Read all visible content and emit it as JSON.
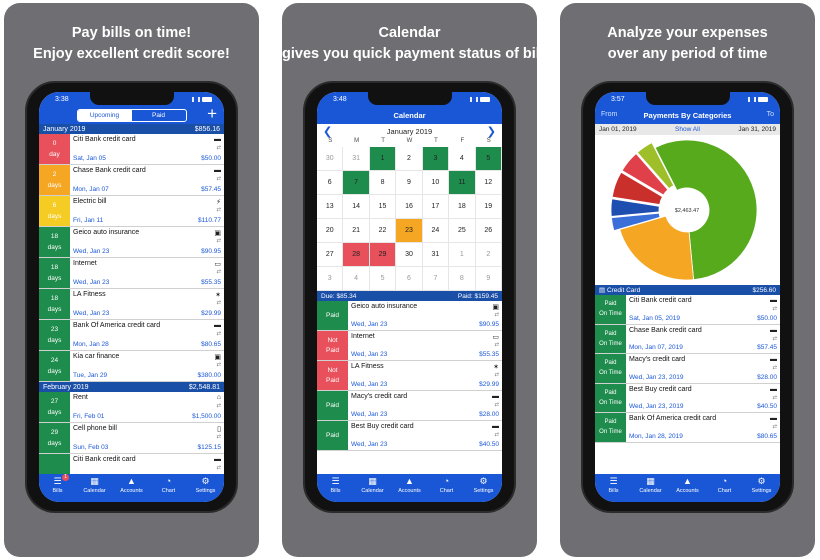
{
  "panels": [
    {
      "heading": [
        "Pay bills on time!",
        "Enjoy excellent credit score!"
      ]
    },
    {
      "heading": [
        "Calendar",
        "gives you quick payment status of bills"
      ]
    },
    {
      "heading": [
        "Analyze your expenses",
        "over any period of time"
      ]
    }
  ],
  "screen1": {
    "time": "3:38",
    "segments": [
      "Upcoming",
      "Paid"
    ],
    "add_label": "+",
    "groups": [
      {
        "month": "January 2019",
        "total": "$856.16",
        "rows": [
          {
            "count": "0",
            "unit": "day",
            "color": "#e8505b",
            "name": "Citi Bank credit card",
            "date": "Sat, Jan 05",
            "amount": "$50.00",
            "icon": "credit-card-icon"
          },
          {
            "count": "2",
            "unit": "days",
            "color": "#f5a623",
            "name": "Chase Bank credit card",
            "date": "Mon, Jan 07",
            "amount": "$57.45",
            "icon": "credit-card-icon"
          },
          {
            "count": "6",
            "unit": "days",
            "color": "#f5cc23",
            "name": "Electric bill",
            "date": "Fri, Jan 11",
            "amount": "$110.77",
            "icon": "bolt-icon"
          },
          {
            "count": "18",
            "unit": "days",
            "color": "#1e8c4c",
            "name": "Geico auto insurance",
            "date": "Wed, Jan 23",
            "amount": "$90.95",
            "icon": "car-icon"
          },
          {
            "count": "18",
            "unit": "days",
            "color": "#1e8c4c",
            "name": "Internet",
            "date": "Wed, Jan 23",
            "amount": "$55.35",
            "icon": "monitor-icon"
          },
          {
            "count": "18",
            "unit": "days",
            "color": "#1e8c4c",
            "name": "LA Fitness",
            "date": "Wed, Jan 23",
            "amount": "$29.99",
            "icon": "fitness-icon"
          },
          {
            "count": "23",
            "unit": "days",
            "color": "#1e8c4c",
            "name": "Bank Of America credit card",
            "date": "Mon, Jan 28",
            "amount": "$80.65",
            "icon": "credit-card-icon"
          },
          {
            "count": "24",
            "unit": "days",
            "color": "#1e8c4c",
            "name": "Kia car finance",
            "date": "Tue, Jan 29",
            "amount": "$380.00",
            "icon": "car-icon"
          }
        ]
      },
      {
        "month": "February 2019",
        "total": "$2,548.81",
        "rows": [
          {
            "count": "27",
            "unit": "days",
            "color": "#1e8c4c",
            "name": "Rent",
            "date": "Fri, Feb 01",
            "amount": "$1,500.00",
            "icon": "home-icon"
          },
          {
            "count": "29",
            "unit": "days",
            "color": "#1e8c4c",
            "name": "Cell phone bill",
            "date": "Sun, Feb 03",
            "amount": "$125.15",
            "icon": "phone-icon"
          },
          {
            "count": "",
            "unit": "",
            "color": "#1e8c4c",
            "name": "Citi Bank credit card",
            "date": "",
            "amount": "",
            "icon": "credit-card-icon"
          }
        ]
      }
    ]
  },
  "screen2": {
    "time": "3:48",
    "title": "Calendar",
    "month": "January 2019",
    "dow": [
      "S",
      "M",
      "T",
      "W",
      "T",
      "F",
      "S"
    ],
    "days": [
      {
        "d": "30",
        "s": "muted"
      },
      {
        "d": "31",
        "s": "muted"
      },
      {
        "d": "1",
        "s": "green"
      },
      {
        "d": "2",
        "s": ""
      },
      {
        "d": "3",
        "s": "green"
      },
      {
        "d": "4",
        "s": ""
      },
      {
        "d": "5",
        "s": "green"
      },
      {
        "d": "6",
        "s": ""
      },
      {
        "d": "7",
        "s": "green"
      },
      {
        "d": "8",
        "s": ""
      },
      {
        "d": "9",
        "s": ""
      },
      {
        "d": "10",
        "s": ""
      },
      {
        "d": "11",
        "s": "green"
      },
      {
        "d": "12",
        "s": ""
      },
      {
        "d": "13",
        "s": ""
      },
      {
        "d": "14",
        "s": ""
      },
      {
        "d": "15",
        "s": ""
      },
      {
        "d": "16",
        "s": ""
      },
      {
        "d": "17",
        "s": ""
      },
      {
        "d": "18",
        "s": ""
      },
      {
        "d": "19",
        "s": ""
      },
      {
        "d": "20",
        "s": ""
      },
      {
        "d": "21",
        "s": ""
      },
      {
        "d": "22",
        "s": ""
      },
      {
        "d": "23",
        "s": "orange"
      },
      {
        "d": "24",
        "s": ""
      },
      {
        "d": "25",
        "s": ""
      },
      {
        "d": "26",
        "s": ""
      },
      {
        "d": "27",
        "s": ""
      },
      {
        "d": "28",
        "s": "red"
      },
      {
        "d": "29",
        "s": "red"
      },
      {
        "d": "30",
        "s": ""
      },
      {
        "d": "31",
        "s": ""
      },
      {
        "d": "1",
        "s": "muted"
      },
      {
        "d": "2",
        "s": "muted"
      },
      {
        "d": "3",
        "s": "muted"
      },
      {
        "d": "4",
        "s": "muted"
      },
      {
        "d": "5",
        "s": "muted"
      },
      {
        "d": "6",
        "s": "muted"
      },
      {
        "d": "7",
        "s": "muted"
      },
      {
        "d": "8",
        "s": "muted"
      },
      {
        "d": "9",
        "s": "muted"
      }
    ],
    "due_label": "Due: $85.34",
    "paid_label": "Paid: $159.45",
    "rows": [
      {
        "status": [
          "Paid"
        ],
        "color": "#1e8c4c",
        "name": "Geico auto insurance",
        "date": "Wed, Jan 23",
        "amount": "$90.95",
        "icon": "car-icon"
      },
      {
        "status": [
          "Not",
          "Paid"
        ],
        "color": "#e8505b",
        "name": "Internet",
        "date": "Wed, Jan 23",
        "amount": "$55.35",
        "icon": "monitor-icon"
      },
      {
        "status": [
          "Not",
          "Paid"
        ],
        "color": "#e8505b",
        "name": "LA Fitness",
        "date": "Wed, Jan 23",
        "amount": "$29.99",
        "icon": "fitness-icon"
      },
      {
        "status": [
          "Paid"
        ],
        "color": "#1e8c4c",
        "name": "Macy's credit card",
        "date": "Wed, Jan 23",
        "amount": "$28.00",
        "icon": "credit-card-icon"
      },
      {
        "status": [
          "Paid"
        ],
        "color": "#1e8c4c",
        "name": "Best Buy credit card",
        "date": "Wed, Jan 23",
        "amount": "$40.50",
        "icon": "credit-card-icon"
      }
    ]
  },
  "screen3": {
    "time": "3:57",
    "title": "Payments By Categories",
    "from_label": "From",
    "to_label": "To",
    "from_date": "Jan 01, 2019",
    "show_all": "Show All",
    "to_date": "Jan 31, 2019",
    "center_total": "$2,463.47",
    "slices": [
      {
        "value": 0.56,
        "color": "#56aa1c"
      },
      {
        "value": 0.22,
        "color": "#f5a623"
      },
      {
        "value": 0.03,
        "color": "#3a6ed8"
      },
      {
        "value": 0.04,
        "color": "#1e4fb0"
      },
      {
        "value": 0.06,
        "color": "#c9302c"
      },
      {
        "value": 0.05,
        "color": "#e0404a"
      },
      {
        "value": 0.04,
        "color": "#9fbf2a"
      }
    ],
    "category_label": "Credit Card",
    "category_total": "$256.60",
    "rows": [
      {
        "status": [
          "Paid",
          "On Time"
        ],
        "name": "Citi Bank credit card",
        "date": "Sat, Jan 05, 2019",
        "amount": "$50.00"
      },
      {
        "status": [
          "Paid",
          "On Time"
        ],
        "name": "Chase Bank credit card",
        "date": "Mon, Jan 07, 2019",
        "amount": "$57.45"
      },
      {
        "status": [
          "Paid",
          "On Time"
        ],
        "name": "Macy's credit card",
        "date": "Wed, Jan 23, 2019",
        "amount": "$28.00"
      },
      {
        "status": [
          "Paid",
          "On Time"
        ],
        "name": "Best Buy credit card",
        "date": "Wed, Jan 23, 2019",
        "amount": "$40.50"
      },
      {
        "status": [
          "Paid",
          "On Time"
        ],
        "name": "Bank Of America credit card",
        "date": "Mon, Jan 28, 2019",
        "amount": "$80.65"
      }
    ]
  },
  "tabs": [
    "Bills",
    "Calendar",
    "Accounts",
    "Chart",
    "Settings"
  ],
  "tab_icons": [
    "list-icon",
    "calendar-icon",
    "bank-icon",
    "pie-chart-icon",
    "gear-icon"
  ],
  "bills_badge": "1",
  "colors": {
    "primary": "#1a57d6",
    "header": "#1a4fa8",
    "green": "#1e8c4c",
    "red": "#e8505b",
    "orange": "#f5a623"
  }
}
